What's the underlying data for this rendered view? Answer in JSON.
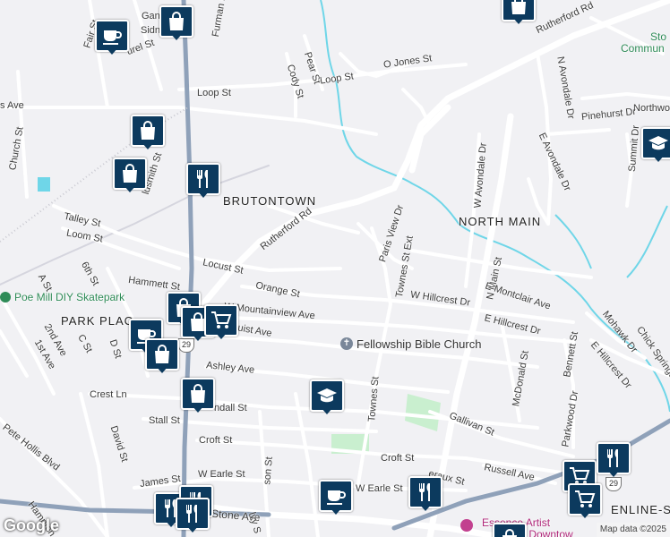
{
  "streets": {
    "rutherford_rd_top": "Rutherford Rd",
    "rutherford_rd_mid": "Rutherford Rd",
    "o_jones_st": "O Jones St",
    "loop_st_left": "Loop St",
    "loop_st_right": "Loop St",
    "cody_st": "Cody St",
    "pear_st": "Pear St",
    "furman_hall": "Furman Ha",
    "gantt": "Gant",
    "sidney": "Sidne",
    "fair_st": "Fair St",
    "laurel_st": "urel St",
    "s_ave": "s Ave",
    "church_st": "Church St",
    "goldsmith_st": "ldsmith St",
    "talley_st": "Talley St",
    "loom_st": "Loom St",
    "hammett_st": "Hammett St",
    "locust_st": "Locust St",
    "orange_st": "Orange St",
    "w_mountainview_ave": "W Mountainview Ave",
    "buist_ave": "Buist Ave",
    "ashley_ave": "Ashley Ave",
    "crest_ln": "Crest Ln",
    "randall_st": "ndall St",
    "stall_st": "Stall St",
    "croft_st_left": "Croft St",
    "croft_st_right": "Croft St",
    "james_st": "James St",
    "w_earle_st_left": "W Earle St",
    "w_earle_st_right": "W Earle St",
    "stone_ave": "Stone Ave",
    "pete_hollis_blvd": "Pete Hollis Blvd",
    "david_st": "David St",
    "richardson_st": "son St",
    "ivy_st": "Ivy S",
    "hampton": "Hampton",
    "a_st": "A St",
    "6th_st": "6th St",
    "2nd_ave": "2nd Ave",
    "c_st": "C St",
    "1st_ave": "1st Ave",
    "d_st": "D St",
    "paris_view_dr": "Paris View Dr",
    "townes_st_ext": "Townes St Ext",
    "townes_st": "Townes St",
    "w_hillcrest_dr": "W Hillcrest Dr",
    "n_main_st": "N Main St",
    "e_montclair_ave": "E Montclair Ave",
    "e_hillcrest_dr_left": "E Hillcrest Dr",
    "e_hillcrest_dr_right": "E Hillcrest Dr",
    "mcdonald_st": "McDonald St",
    "bennett_st": "Bennett St",
    "mohawk_dr": "Mohawk Dr",
    "chick_springs_rd": "Chick Springs Rd",
    "parkwood_dr": "Parkwood Dr",
    "gallivan_st": "Gallivan St",
    "russell_ave": "Russell Ave",
    "earaux_st": "eraux St",
    "w_avondale_dr": "W Avondale Dr",
    "n_avondale_dr": "N Avondale Dr",
    "e_avondale_dr": "E Avondale Dr",
    "pinehurst_dr": "Pinehurst Dr",
    "northwood": "Northwo",
    "summit_dr": "Summit Dr"
  },
  "neighborhoods": {
    "brutontown": "BRUTONTOWN",
    "north_main": "NORTH MAIN",
    "park_place": "PARK PLAC",
    "stone_lake": "ENLINE-SP"
  },
  "pois": {
    "poe_mill": "Poe Mill DIY Skatepark",
    "fellowship_bible": "Fellowship Bible Church",
    "stone_community": "Sto",
    "stone_community_2": "Commun",
    "essence_artist": "Essence Artist",
    "essence_artist_2": "ille - Downtow"
  },
  "shields": {
    "route_29_a": "29",
    "route_29_b": "29"
  },
  "footer": {
    "logo": "Google",
    "attribution": "Map data ©2025"
  },
  "colors": {
    "background": "#f1f1f4",
    "road": "#ffffff",
    "road_outline": "#d9d9e0",
    "highway": "#8a9bb3",
    "water": "#6fd6e8",
    "park": "#c9efcf",
    "marker": "#0c3a5e"
  },
  "markers": [
    {
      "icon": "coffee-icon",
      "kind": "cafe"
    },
    {
      "icon": "shopping-bag-icon",
      "kind": "store"
    },
    {
      "icon": "shopping-bag-icon",
      "kind": "store"
    },
    {
      "icon": "shopping-bag-icon",
      "kind": "store"
    },
    {
      "icon": "shopping-bag-icon",
      "kind": "store"
    },
    {
      "icon": "restaurant-icon",
      "kind": "restaurant"
    },
    {
      "icon": "shopping-bag-icon",
      "kind": "store"
    },
    {
      "icon": "shopping-bag-icon",
      "kind": "store"
    },
    {
      "icon": "shopping-cart-icon",
      "kind": "grocery"
    },
    {
      "icon": "coffee-icon",
      "kind": "cafe"
    },
    {
      "icon": "shopping-bag-icon",
      "kind": "store"
    },
    {
      "icon": "shopping-bag-icon",
      "kind": "store"
    },
    {
      "icon": "school-icon",
      "kind": "school"
    },
    {
      "icon": "school-icon",
      "kind": "school"
    },
    {
      "icon": "restaurant-icon",
      "kind": "restaurant"
    },
    {
      "icon": "restaurant-icon",
      "kind": "restaurant"
    },
    {
      "icon": "coffee-icon",
      "kind": "cafe"
    },
    {
      "icon": "restaurant-icon",
      "kind": "restaurant"
    },
    {
      "icon": "shopping-cart-icon",
      "kind": "grocery"
    },
    {
      "icon": "shopping-cart-icon",
      "kind": "grocery"
    },
    {
      "icon": "restaurant-icon",
      "kind": "restaurant"
    },
    {
      "icon": "restaurant-icon",
      "kind": "restaurant"
    },
    {
      "icon": "shopping-bag-icon",
      "kind": "store"
    }
  ]
}
